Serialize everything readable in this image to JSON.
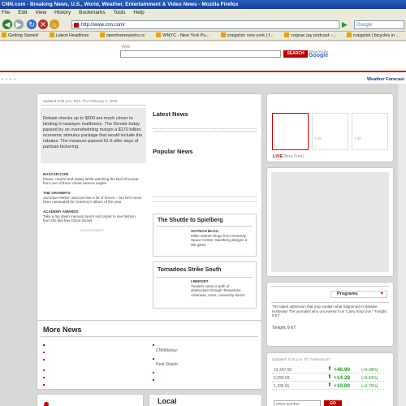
{
  "window": {
    "title": "CNN.com - Breaking News, U.S., World, Weather, Entertainment & Video News - Mozilla Firefox"
  },
  "menu": [
    "File",
    "Edit",
    "View",
    "History",
    "Bookmarks",
    "Tools",
    "Help"
  ],
  "nav": {
    "url": "http://www.cnn.com/",
    "search_placeholder": "Google"
  },
  "bookmarks": [
    "Getting Started",
    "Latest Headlines",
    "openframeworks.cc",
    "WNYC - New York Pu...",
    "craigslist: new york | f...",
    "cognac jay podcast -...",
    "craigslist | bicycles in ..."
  ],
  "masthead": {
    "web_label": "Web",
    "search_button": "SEARCH",
    "powered_by": "Powered By",
    "google": "Google",
    "weather_link": "Weather Forecast"
  },
  "main": {
    "updated": "updated 6:59 p.m. EST, Thu February 7, 2008",
    "lead_text": "Rebate checks up to $600 are much closer to landing in taxpayer mailboxes. The Senate today passed by an overwhelming margin a $170 billion economic stimulus package that would include the rebates. The measure passed 91-6 after days of partisan bickering.",
    "stories": [
      {
        "label": "NASCAR.COM",
        "text": "Pause, rewind and replay while watching the Bud Shootout from one of three virtual camera angles"
      },
      {
        "label": "The Grammys",
        "text": "Jazzman Herbie Hancock has a lot of forces -- but he's never been nominated for Grammy's album of the year"
      },
      {
        "label": "Academy Awards",
        "text": "Take a trip down memory lane's red carpet to see fashion from the last few Oscar shows"
      }
    ],
    "ad_label": "ADVERTISEMENT",
    "latest_news": "Latest News",
    "popular_news": "Popular News",
    "feature1": {
      "title": "The Shuttle to Spielberg",
      "label": "SCITECH BLOG",
      "text": "Miles O'Brien blogs from Kennedy Space Center, Spielberg designs a Wii game"
    },
    "feature2": {
      "title": "Tornadoes Strike South",
      "label": "I-REPORT",
      "text": "Twisters carve a path of destruction through Tennessee, Arkansas, more, university dorms"
    }
  },
  "more_news": {
    "title": "More News",
    "cnnmoney": "CNNMoney:",
    "real_simple": "Real Simple:"
  },
  "local": {
    "title": "Local"
  },
  "video": {
    "times": [
      "",
      "2:38",
      "1:40"
    ],
    "live_label": "LIVE",
    "live_text": "(Now Free)"
  },
  "tv": {
    "programs": "Programs",
    "blurb": "The taped admission that may explain what happened to Natalee Holloway! The journalist who uncovered it on \"Larry King Live.\" Tonight, 9 ET",
    "tonight": "Tonight, 9 ET"
  },
  "markets": {
    "updated": "Updated: 5:15 p.m. ET, February 07",
    "rows": [
      {
        "name": "12,247.00",
        "change": "+46.90",
        "pct": "(+0.38%)"
      },
      {
        "name": "2,293.03",
        "change": "+14.28",
        "pct": "(+0.63%)"
      },
      {
        "name": "1,336.91",
        "change": "+10.00",
        "pct": "(+0.75%)"
      }
    ],
    "symbol_placeholder": "enter symbol",
    "go_label": "GO"
  },
  "colors": {
    "cnn_red": "#cc0000",
    "gain_green": "#1a9c1a",
    "link_blue": "#003d99"
  }
}
